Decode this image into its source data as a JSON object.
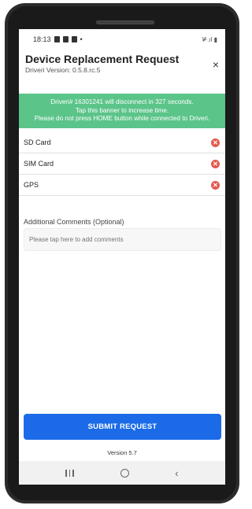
{
  "status_bar": {
    "time": "18:13",
    "dot": "•",
    "right_icons": "¥ͣ .ıl ▮"
  },
  "header": {
    "title": "Device Replacement Request",
    "version": "Driveri Version: 0.5.8.rc.5",
    "close_label": "×"
  },
  "banner": {
    "line1": "Driveri# 16301241 will disconnect in 327 seconds.",
    "line2": "Tap this banner to increase time.",
    "line3": "Please do not press HOME button while connected to Driveri.",
    "color": "#5bc489"
  },
  "items": [
    {
      "label": "SD Card"
    },
    {
      "label": "SIM Card"
    },
    {
      "label": "GPS"
    }
  ],
  "status_icon_color": "#e35a4f",
  "comments": {
    "label": "Additional Comments (Optional)",
    "placeholder": "Please tap here to add comments"
  },
  "submit": {
    "label": "SUBMIT REQUEST",
    "color": "#1b6be8"
  },
  "footer": {
    "version": "Version 5.7"
  }
}
